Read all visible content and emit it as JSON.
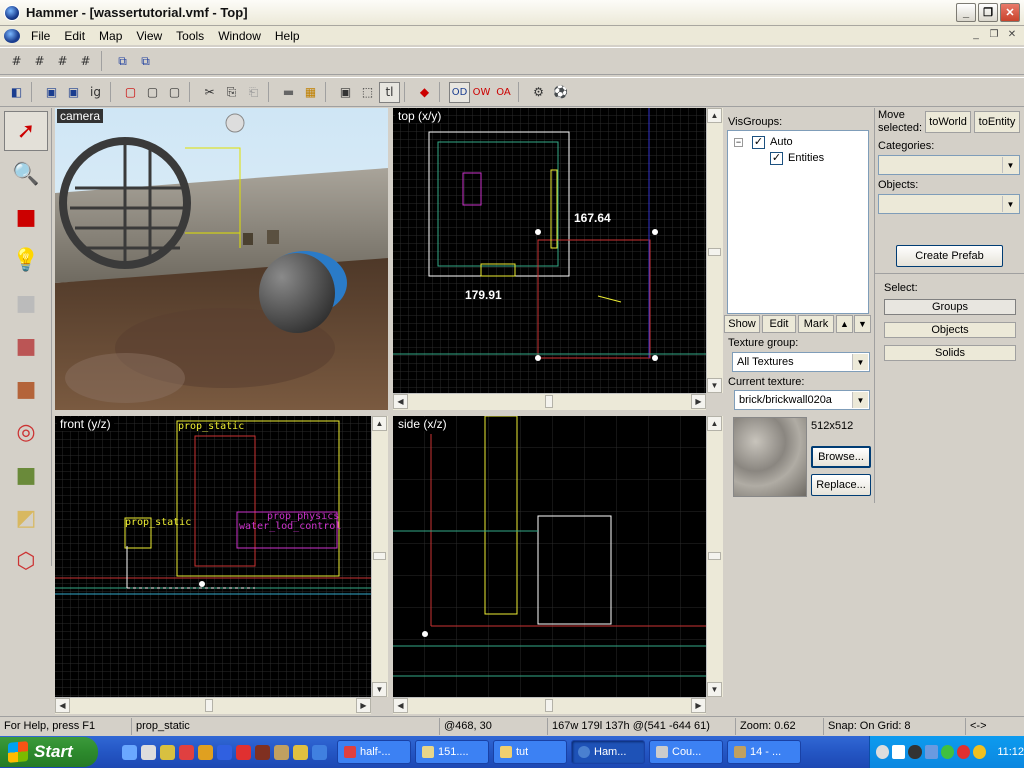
{
  "window": {
    "title": "Hammer - [wassertutorial.vmf - Top]"
  },
  "menu": [
    "File",
    "Edit",
    "Map",
    "View",
    "Tools",
    "Window",
    "Help"
  ],
  "viewports": {
    "camera": {
      "label": "camera"
    },
    "top": {
      "label": "top (x/y)",
      "dim_width": "167.64",
      "dim_height": "179.91"
    },
    "front": {
      "label": "front (y/z)",
      "entity1": "prop_static",
      "entity2": "prop_static",
      "entity3": "prop_physics",
      "entity4": "water_lod_control"
    },
    "side": {
      "label": "side (x/z)"
    }
  },
  "panel": {
    "visgroups_label": "VisGroups:",
    "tree_auto": "Auto",
    "tree_entities": "Entities",
    "show": "Show",
    "edit": "Edit",
    "mark": "Mark",
    "up": "▲",
    "down": "▼",
    "move_selected_line1": "Move",
    "move_selected_line2": "selected:",
    "to_world": "toWorld",
    "to_entity": "toEntity",
    "categories_label": "Categories:",
    "objects_label": "Objects:",
    "create_prefab": "Create Prefab",
    "select_label": "Select:",
    "groups": "Groups",
    "objects": "Objects",
    "solids": "Solids",
    "texture_group_label": "Texture group:",
    "texture_group_value": "All Textures",
    "current_texture_label": "Current texture:",
    "current_texture_value": "brick/brickwall020a",
    "texture_size": "512x512",
    "browse": "Browse...",
    "replace": "Replace..."
  },
  "status": {
    "help": "For Help, press F1",
    "selection": "prop_static",
    "coords": "@468, 30",
    "size": "167w 179l 137h @(541 -644 61)",
    "zoom": "Zoom: 0.62",
    "snap": "Snap: On Grid: 8",
    "arrows": "<->"
  },
  "taskbar": {
    "start": "Start",
    "tasks": [
      "half-...",
      "151....",
      "tut",
      "Ham...",
      "Cou...",
      "14 - ..."
    ],
    "clock": "11:12"
  }
}
